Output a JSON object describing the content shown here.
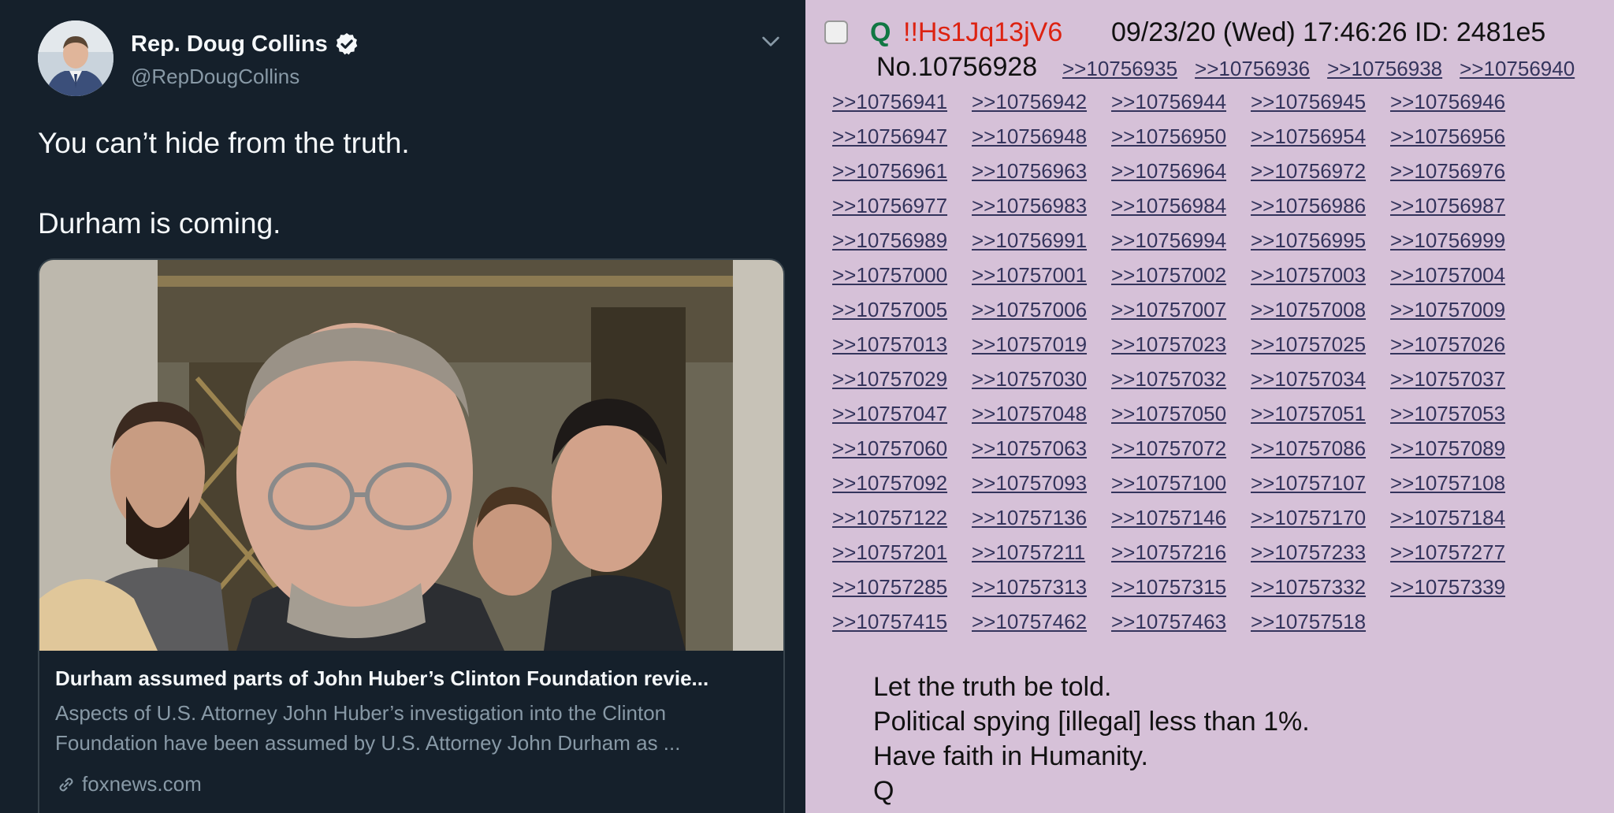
{
  "tweet": {
    "display_name": "Rep. Doug Collins",
    "handle": "@RepDougCollins",
    "text_line1": "You can’t hide from the truth.",
    "text_line2": "Durham is coming.",
    "card": {
      "title": "Durham assumed parts of John Huber’s Clinton Foundation revie...",
      "description_line1": "Aspects of U.S. Attorney John Huber’s investigation into the Clinton",
      "description_line2": "Foundation have been assumed by U.S. Attorney John Durham as ...",
      "domain": "foxnews.com"
    },
    "icons": [
      "avatar-photo",
      "verified-badge-icon",
      "chevron-down-icon",
      "link-icon"
    ],
    "colors": {
      "background": "#15202b",
      "text": "#f5f8fa",
      "secondary": "#8899a6",
      "border": "#38444d"
    }
  },
  "post": {
    "name": "Q",
    "tripcode": "!!Hs1Jq13jV6",
    "datetime": "09/23/20 (Wed) 17:46:26 ID: 2481e5",
    "number": "No.10756928",
    "first_line_replies": [
      ">>10756935",
      ">>10756936",
      ">>10756938",
      ">>10756940"
    ],
    "replies": [
      ">>10756941",
      ">>10756942",
      ">>10756944",
      ">>10756945",
      ">>10756946",
      ">>10756947",
      ">>10756948",
      ">>10756950",
      ">>10756954",
      ">>10756956",
      ">>10756961",
      ">>10756963",
      ">>10756964",
      ">>10756972",
      ">>10756976",
      ">>10756977",
      ">>10756983",
      ">>10756984",
      ">>10756986",
      ">>10756987",
      ">>10756989",
      ">>10756991",
      ">>10756994",
      ">>10756995",
      ">>10756999",
      ">>10757000",
      ">>10757001",
      ">>10757002",
      ">>10757003",
      ">>10757004",
      ">>10757005",
      ">>10757006",
      ">>10757007",
      ">>10757008",
      ">>10757009",
      ">>10757013",
      ">>10757019",
      ">>10757023",
      ">>10757025",
      ">>10757026",
      ">>10757029",
      ">>10757030",
      ">>10757032",
      ">>10757034",
      ">>10757037",
      ">>10757047",
      ">>10757048",
      ">>10757050",
      ">>10757051",
      ">>10757053",
      ">>10757060",
      ">>10757063",
      ">>10757072",
      ">>10757086",
      ">>10757089",
      ">>10757092",
      ">>10757093",
      ">>10757100",
      ">>10757107",
      ">>10757108",
      ">>10757122",
      ">>10757136",
      ">>10757146",
      ">>10757170",
      ">>10757184",
      ">>10757201",
      ">>10757211",
      ">>10757216",
      ">>10757233",
      ">>10757277",
      ">>10757285",
      ">>10757313",
      ">>10757315",
      ">>10757332",
      ">>10757339",
      ">>10757415",
      ">>10757462",
      ">>10757463",
      ">>10757518"
    ],
    "message": [
      "Let the truth be told.",
      "Political spying [illegal] less than 1%.",
      "Have faith in Humanity.",
      "Q"
    ],
    "colors": {
      "background": "#d6c1d8",
      "name": "#117743",
      "tripcode": "#dd2211",
      "link": "#34345c"
    }
  }
}
